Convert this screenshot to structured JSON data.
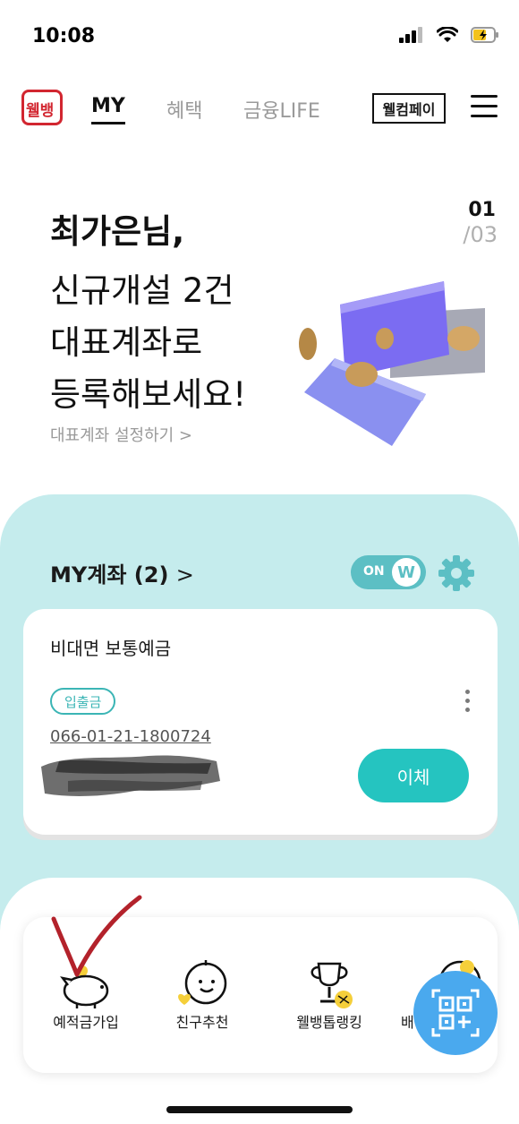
{
  "status_bar": {
    "time": "10:08"
  },
  "nav": {
    "logo_text": "웰뱅",
    "tabs": [
      {
        "label": "MY",
        "active": true
      },
      {
        "label": "혜택",
        "active": false
      },
      {
        "label": "금융LIFE",
        "active": false
      }
    ],
    "pay_label": "웰컴페이",
    "menu_icon": "hamburger-icon"
  },
  "hero": {
    "title": "최가은님,",
    "lines": [
      "신규개설 2건",
      "대표계좌로",
      "등록해보세요!"
    ],
    "link": "대표계좌 설정하기  >",
    "page_current": "01",
    "page_total": "/03"
  },
  "accounts": {
    "header": "MY계좌 (2)",
    "toggle_label": "ON",
    "toggle_knob": "W",
    "toggle_on": true,
    "card": {
      "name": "비대면 보통예금",
      "badge": "입출금",
      "account_number": "066-01-21-1800724",
      "transfer_label": "이체"
    }
  },
  "quick_menu": {
    "items": [
      {
        "label": "예적금가입",
        "icon": "piggy-bank-icon"
      },
      {
        "label": "친구추천",
        "icon": "friend-face-icon"
      },
      {
        "label": "웰뱅톱랭킹",
        "icon": "trophy-icon"
      },
      {
        "label": "배",
        "icon": "partial-icon"
      }
    ]
  },
  "colors": {
    "brand_red": "#d22630",
    "mint_bg": "#c5eced",
    "accent_teal": "#25c4c0",
    "qr_blue": "#4aa9ee"
  }
}
